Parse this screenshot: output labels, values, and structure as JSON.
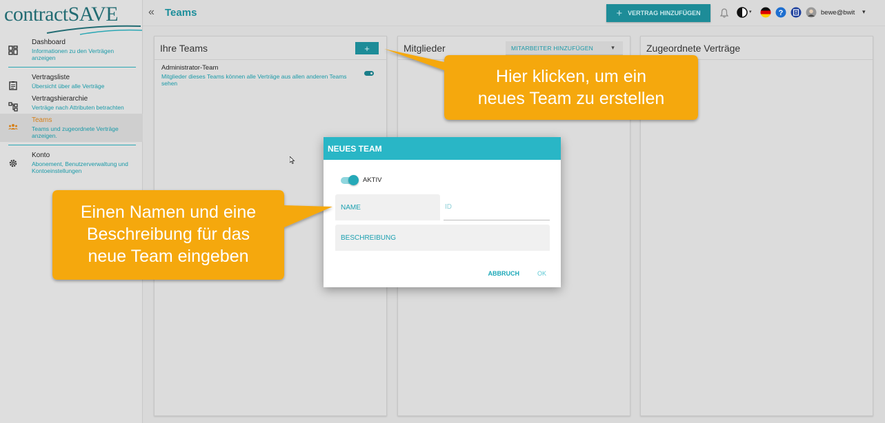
{
  "app": {
    "logo_text": "contractSAVE"
  },
  "sidebar": {
    "items": [
      {
        "title": "Dashboard",
        "desc": "Informationen zu den Verträgen anzeigen",
        "icon": "dashboard-icon"
      },
      {
        "title": "Vertragsliste",
        "desc": "Übersicht über alle Verträge",
        "icon": "clipboard-icon"
      },
      {
        "title": "Vertragshierarchie",
        "desc": "Verträge nach Attributen betrachten",
        "icon": "hierarchy-icon"
      },
      {
        "title": "Teams",
        "desc": "Teams und zugeordnete Verträge anzeigen.",
        "icon": "people-icon"
      },
      {
        "title": "Konto",
        "desc": "Abonement, Benutzerverwaltung und Kontoeinstellungen",
        "icon": "gear-icon"
      }
    ],
    "active_index": 3
  },
  "topbar": {
    "collapse_glyph": "«",
    "title": "Teams",
    "add_contract_label": "VERTRAG HINZUFÜGEN",
    "plus_glyph": "+",
    "user": "bewe@bwit",
    "caret": "▾"
  },
  "panels": {
    "teams": {
      "title": "Ihre Teams",
      "add_glyph": "+",
      "rows": [
        {
          "name": "Administrator-Team",
          "desc": "Mitglieder dieses Teams können alle Verträge aus allen anderen Teams sehen",
          "active": true
        }
      ]
    },
    "members": {
      "title": "Mitglieder",
      "select_label": "MITARBEITER HINZUFÜGEN",
      "caret": "▾"
    },
    "contracts": {
      "title": "Zugeordnete Verträge"
    }
  },
  "dialog": {
    "title": "NEUES TEAM",
    "toggle_label": "AKTIV",
    "toggle_on": true,
    "name_placeholder": "NAME",
    "id_placeholder": "ID",
    "desc_placeholder": "BESCHREIBUNG",
    "cancel_label": "ABBRUCH",
    "ok_label": "OK"
  },
  "callouts": {
    "top": [
      "Hier klicken, um ein",
      "neues Team zu erstellen"
    ],
    "left": [
      "Einen Namen und eine",
      "Beschreibung für das",
      "neue Team eingeben"
    ]
  },
  "colors": {
    "accent": "#1d8c98",
    "dialog_header": "#29b6c6",
    "callout": "#f5a80e",
    "active_nav": "#d5801a"
  }
}
